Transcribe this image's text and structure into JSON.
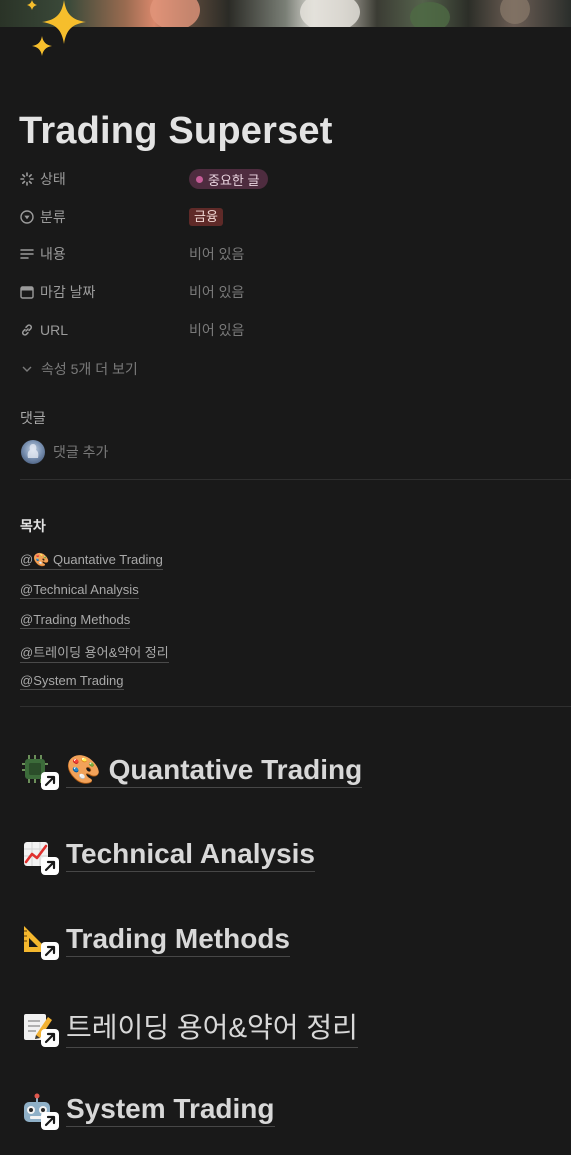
{
  "page": {
    "title": "Trading Superset",
    "icon": "sparkles-icon"
  },
  "properties": [
    {
      "name": "상태",
      "icon": "status-icon",
      "value": "중요한 글",
      "type": "status"
    },
    {
      "name": "분류",
      "icon": "select-icon",
      "value": "금융",
      "type": "select"
    },
    {
      "name": "내용",
      "icon": "text-icon",
      "value": "비어 있음",
      "type": "empty"
    },
    {
      "name": "마감 날짜",
      "icon": "calendar-icon",
      "value": "비어 있음",
      "type": "empty"
    },
    {
      "name": "URL",
      "icon": "link-icon",
      "value": "비어 있음",
      "type": "empty"
    }
  ],
  "more_properties": "속성 5개 더 보기",
  "comments": {
    "heading": "댓글",
    "add_label": "댓글 추가"
  },
  "toc": {
    "heading": "목차",
    "items": [
      "@🎨 Quantative Trading",
      "@Technical Analysis",
      "@Trading Methods",
      "@트레이딩 용어&약어 정리",
      "@System Trading"
    ]
  },
  "headings": [
    {
      "text": "🎨 Quantative Trading",
      "icon": "chip-icon"
    },
    {
      "text": "Technical Analysis",
      "icon": "chart-up-icon"
    },
    {
      "text": "Trading Methods",
      "icon": "triangle-ruler-icon"
    },
    {
      "text": "트레이딩 용어&약어 정리",
      "icon": "memo-icon"
    },
    {
      "text": "System Trading",
      "icon": "robot-icon"
    }
  ],
  "colors": {
    "background": "#191919",
    "status_tag_bg": "#4e2c3f",
    "status_dot": "#c55c97",
    "select_tag_bg": "#5f2a28"
  }
}
